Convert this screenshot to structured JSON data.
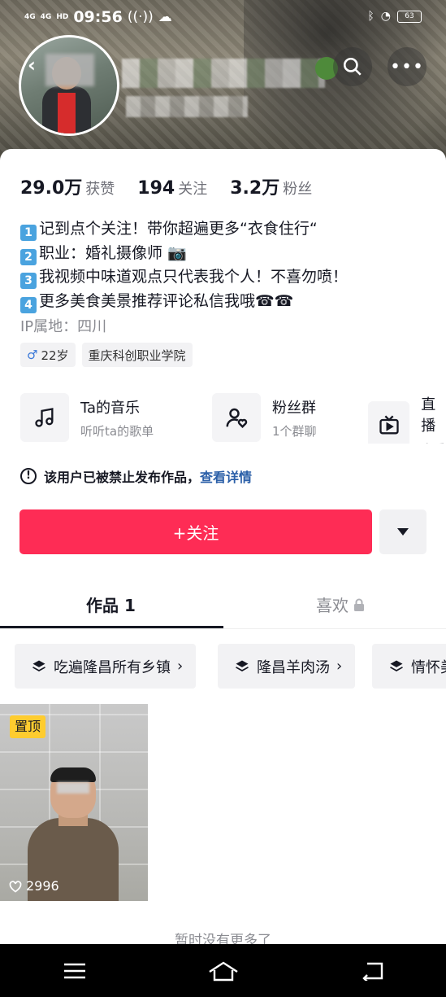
{
  "status_bar": {
    "signal1": "4G",
    "signal2": "4G",
    "hd": "HD",
    "time": "09:56",
    "battery": "63"
  },
  "profile": {
    "stats": [
      {
        "value": "29.0万",
        "label": "获赞"
      },
      {
        "value": "194",
        "label": "关注"
      },
      {
        "value": "3.2万",
        "label": "粉丝"
      }
    ],
    "bio": [
      {
        "num": "1",
        "text": "记到点个关注！带你超遍更多“衣食住行“"
      },
      {
        "num": "2",
        "text": "职业：婚礼摄像师 📷"
      },
      {
        "num": "3",
        "text": "我视频中味道观点只代表我个人！不喜勿喷！"
      },
      {
        "num": "4",
        "text": "更多美食美景推荐评论私信我哦☎☎"
      }
    ],
    "ip_location": "IP属地：四川",
    "tags": {
      "age": "22岁",
      "school": "重庆科创职业学院"
    }
  },
  "features": [
    {
      "title": "Ta的音乐",
      "subtitle": "听听ta的歌单",
      "icon": "music-note-icon"
    },
    {
      "title": "粉丝群",
      "subtitle": "1个群聊",
      "icon": "fan-group-icon"
    },
    {
      "title": "直播",
      "subtitle": "查看",
      "icon": "tv-icon"
    }
  ],
  "notice": {
    "text": "该用户已被禁止发布作品，",
    "link": "查看详情"
  },
  "actions": {
    "follow_label": "+关注"
  },
  "tabs": {
    "works": "作品 1",
    "likes": "喜欢"
  },
  "collections": [
    {
      "label": "吃遍隆昌所有乡镇"
    },
    {
      "label": "隆昌羊肉汤"
    },
    {
      "label": "情怀美食"
    }
  ],
  "videos": [
    {
      "badge": "置顶",
      "likes": "2996"
    }
  ],
  "footer": {
    "no_more": "暂时没有更多了"
  },
  "colors": {
    "accent": "#fe2c55",
    "link": "#2b5fa8",
    "pinned": "#fecc2f"
  }
}
